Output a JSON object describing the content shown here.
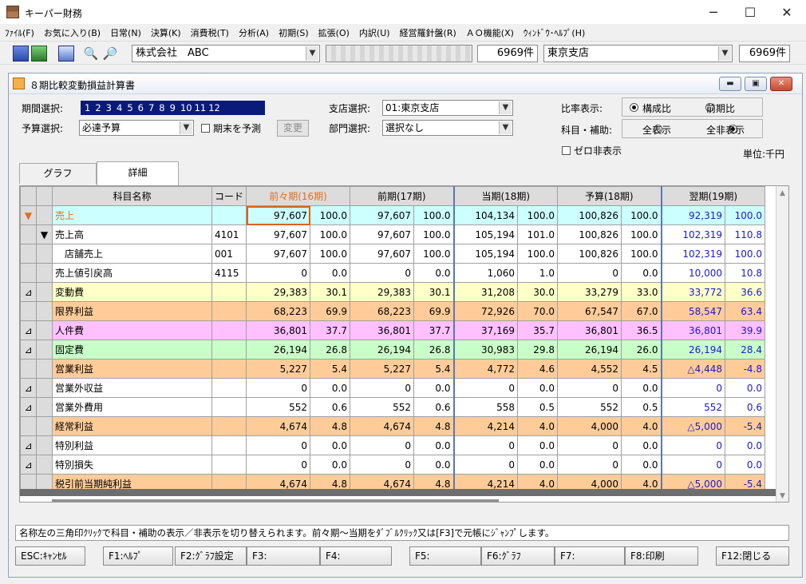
{
  "app": {
    "title": "キーパー財務",
    "min": "─",
    "max": "☐",
    "close": "✕"
  },
  "menu": [
    "ﾌｧｲﾙ(F)",
    "お気に入り(B)",
    "日常(N)",
    "決算(K)",
    "消費税(T)",
    "分析(A)",
    "初期(S)",
    "拡張(O)",
    "内訳(U)",
    "経営羅針盤(R)",
    "ＡＯ機能(X)",
    "ｳｨﾝﾄﾞｳ･ﾍﾙﾌﾟ(H)"
  ],
  "toolbar": {
    "company": "株式会社　ABC",
    "count1": "6969件",
    "branch": "東京支店",
    "count2": "6969件"
  },
  "window": {
    "title": "８期比較変動損益計算書"
  },
  "form": {
    "period_label": "期間選択:",
    "periods": [
      "1",
      "2",
      "3",
      "4",
      "5",
      "6",
      "7",
      "8",
      "9",
      "10",
      "11",
      "12"
    ],
    "budget_label": "予算選択:",
    "budget_value": "必達予算",
    "predict_label": "期末を予測",
    "change_button": "変更",
    "branch_label": "支店選択:",
    "branch_value": "01:東京支店",
    "dept_label": "部門選択:",
    "dept_value": "選択なし",
    "ratio_label": "比率表示:",
    "ratio_opt1": "構成比",
    "ratio_opt2": "前期比",
    "sub_label": "科目・補助:",
    "sub_opt1": "全表示",
    "sub_opt2": "全非表示",
    "zero_label": "ゼロ非表示",
    "unit": "単位:千円"
  },
  "tabs": [
    "グラフ",
    "詳細"
  ],
  "grid": {
    "headers": [
      "科目名称",
      "コード",
      "前々期(16期)",
      "前期(17期)",
      "当期(18期)",
      "予算(18期)",
      "翌期(19期)"
    ],
    "rows": [
      {
        "tri": "▼",
        "arrow": "",
        "name": "売上",
        "code": "",
        "cls": "c",
        "v": [
          "97,607",
          "100.0",
          "97,607",
          "100.0",
          "104,134",
          "100.0",
          "100,826",
          "100.0",
          "92,319",
          "100.0"
        ]
      },
      {
        "tri": "",
        "arrow": "▼",
        "name": "売上高",
        "code": "4101",
        "cls": "w",
        "v": [
          "97,607",
          "100.0",
          "97,607",
          "100.0",
          "105,194",
          "101.0",
          "100,826",
          "100.0",
          "102,319",
          "110.8"
        ]
      },
      {
        "tri": "",
        "arrow": "",
        "name": "　店舗売上",
        "code": "001",
        "cls": "w",
        "v": [
          "97,607",
          "100.0",
          "97,607",
          "100.0",
          "105,194",
          "100.0",
          "100,826",
          "100.0",
          "102,319",
          "100.0"
        ]
      },
      {
        "tri": "",
        "arrow": "",
        "name": "売上値引戻高",
        "code": "4115",
        "cls": "w",
        "v": [
          "0",
          "0.0",
          "0",
          "0.0",
          "1,060",
          "1.0",
          "0",
          "0.0",
          "10,000",
          "10.8"
        ]
      },
      {
        "tri": "⊿",
        "arrow": "",
        "name": "変動費",
        "code": "",
        "cls": "y",
        "v": [
          "29,383",
          "30.1",
          "29,383",
          "30.1",
          "31,208",
          "30.0",
          "33,279",
          "33.0",
          "33,772",
          "36.6"
        ]
      },
      {
        "tri": "",
        "arrow": "",
        "name": "限界利益",
        "code": "",
        "cls": "o",
        "v": [
          "68,223",
          "69.9",
          "68,223",
          "69.9",
          "72,926",
          "70.0",
          "67,547",
          "67.0",
          "58,547",
          "63.4"
        ]
      },
      {
        "tri": "⊿",
        "arrow": "",
        "name": "人件費",
        "code": "",
        "cls": "p",
        "v": [
          "36,801",
          "37.7",
          "36,801",
          "37.7",
          "37,169",
          "35.7",
          "36,801",
          "36.5",
          "36,801",
          "39.9"
        ]
      },
      {
        "tri": "⊿",
        "arrow": "",
        "name": "固定費",
        "code": "",
        "cls": "g",
        "v": [
          "26,194",
          "26.8",
          "26,194",
          "26.8",
          "30,983",
          "29.8",
          "26,194",
          "26.0",
          "26,194",
          "28.4"
        ]
      },
      {
        "tri": "",
        "arrow": "",
        "name": "営業利益",
        "code": "",
        "cls": "o",
        "v": [
          "5,227",
          "5.4",
          "5,227",
          "5.4",
          "4,772",
          "4.6",
          "4,552",
          "4.5",
          "△4,448",
          "-4.8"
        ]
      },
      {
        "tri": "⊿",
        "arrow": "",
        "name": "営業外収益",
        "code": "",
        "cls": "w",
        "v": [
          "0",
          "0.0",
          "0",
          "0.0",
          "0",
          "0.0",
          "0",
          "0.0",
          "0",
          "0.0"
        ]
      },
      {
        "tri": "⊿",
        "arrow": "",
        "name": "営業外費用",
        "code": "",
        "cls": "w",
        "v": [
          "552",
          "0.6",
          "552",
          "0.6",
          "558",
          "0.5",
          "552",
          "0.5",
          "552",
          "0.6"
        ]
      },
      {
        "tri": "",
        "arrow": "",
        "name": "経常利益",
        "code": "",
        "cls": "o",
        "v": [
          "4,674",
          "4.8",
          "4,674",
          "4.8",
          "4,214",
          "4.0",
          "4,000",
          "4.0",
          "△5,000",
          "-5.4"
        ]
      },
      {
        "tri": "⊿",
        "arrow": "",
        "name": "特別利益",
        "code": "",
        "cls": "w",
        "v": [
          "0",
          "0.0",
          "0",
          "0.0",
          "0",
          "0.0",
          "0",
          "0.0",
          "0",
          "0.0"
        ]
      },
      {
        "tri": "⊿",
        "arrow": "",
        "name": "特別損失",
        "code": "",
        "cls": "w",
        "v": [
          "0",
          "0.0",
          "0",
          "0.0",
          "0",
          "0.0",
          "0",
          "0.0",
          "0",
          "0.0"
        ]
      },
      {
        "tri": "",
        "arrow": "",
        "name": "税引前当期純利益",
        "code": "",
        "cls": "o",
        "v": [
          "4,674",
          "4.8",
          "4,674",
          "4.8",
          "4,214",
          "4.0",
          "4,000",
          "4.0",
          "△5,000",
          "-5.4"
        ]
      }
    ]
  },
  "status_text": "名称左の三角印ｸﾘｯｸで科目・補助の表示／非表示を切り替えられます。前々期～当期をﾀﾞﾌﾞﾙｸﾘｯｸ又は[F3]で元帳にｼﾞｬﾝﾌﾟします。",
  "fkeys": [
    "ESC:ｷｬﾝｾﾙ",
    "F1:ﾍﾙﾌﾟ",
    "F2:ｸﾞﾗﾌ設定",
    "F3:",
    "F4:",
    "F5:",
    "F6:ｸﾞﾗﾌ",
    "F7:",
    "F8:印刷",
    "F12:閉じる"
  ],
  "colors": {
    "period_bg": "#0a1a7a",
    "selected_outline": "#e06010",
    "blue_text": "#1a1acc",
    "header_highlight": "#e07020"
  }
}
